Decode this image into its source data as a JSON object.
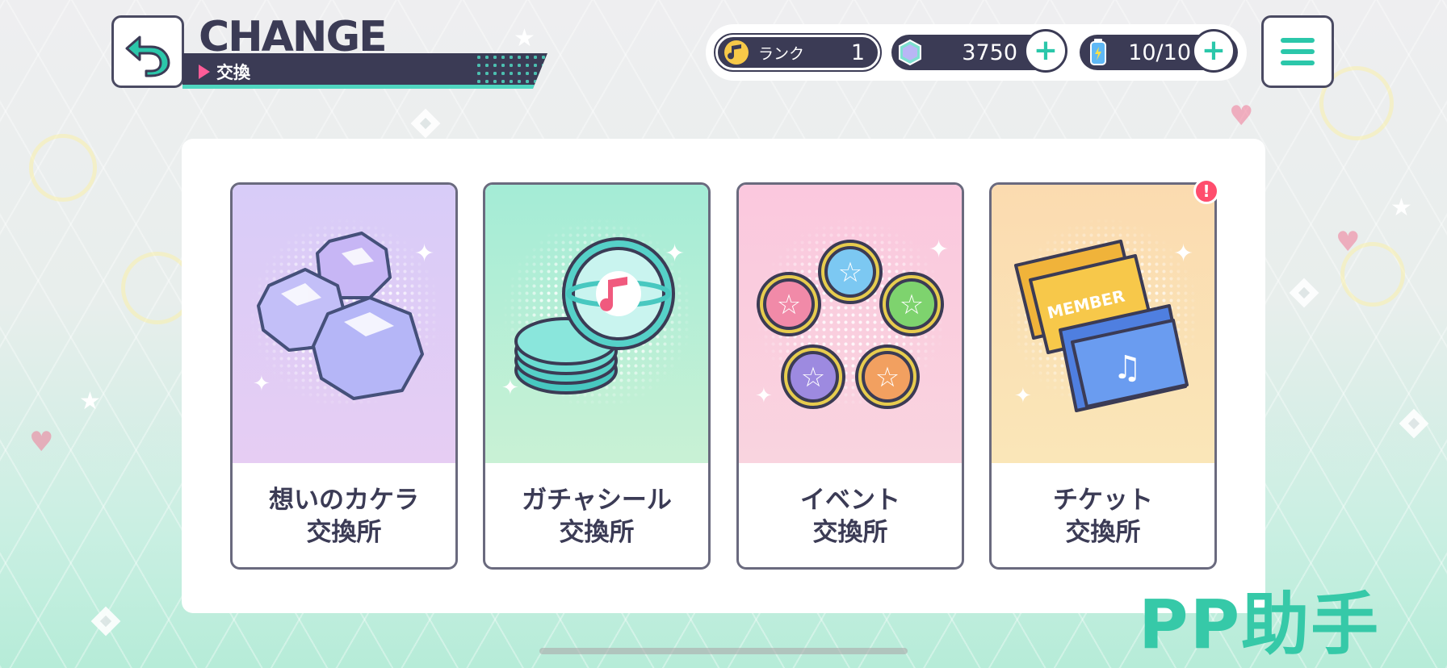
{
  "header": {
    "title": "CHANGE",
    "subtitle": "交換"
  },
  "status": {
    "rank_label": "ランク",
    "rank_value": "1",
    "gem_value": "3750",
    "energy_value": "10/10",
    "plus_label": "+"
  },
  "cards": [
    {
      "line1": "想いのカケラ",
      "line2": "交換所",
      "icon": "crystal-shards-icon"
    },
    {
      "line1": "ガチャシール",
      "line2": "交換所",
      "icon": "gacha-seal-icon"
    },
    {
      "line1": "イベント",
      "line2": "交換所",
      "icon": "event-medals-icon"
    },
    {
      "line1": "チケット",
      "line2": "交換所",
      "icon": "tickets-icon"
    }
  ],
  "ticket_card": {
    "member_text": "MEMBER",
    "notice_badge": "!"
  },
  "watermark": "PP助手",
  "colors": {
    "navy": "#3b3b55",
    "accent_teal": "#2bc7aa",
    "accent_pink": "#ff5c98",
    "badge_red": "#ff4d6d"
  }
}
